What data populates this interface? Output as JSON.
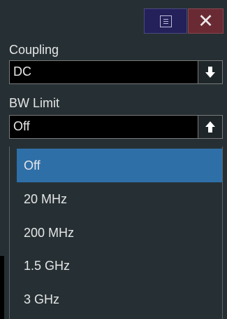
{
  "window": {
    "menu_icon": "menu-icon",
    "close_label": "✕"
  },
  "coupling": {
    "label": "Coupling",
    "value": "DC",
    "arrow": "arrow-down-icon"
  },
  "bw_limit": {
    "label": "BW Limit",
    "value": "Off",
    "arrow": "arrow-up-icon",
    "options": [
      "Off",
      "20 MHz",
      "200 MHz",
      "1.5 GHz",
      "3 GHz"
    ],
    "selected_index": 0
  },
  "colors": {
    "panel": "#263034",
    "selected": "#2f6fa8",
    "close": "#6a2a33",
    "menu": "#23205a"
  }
}
